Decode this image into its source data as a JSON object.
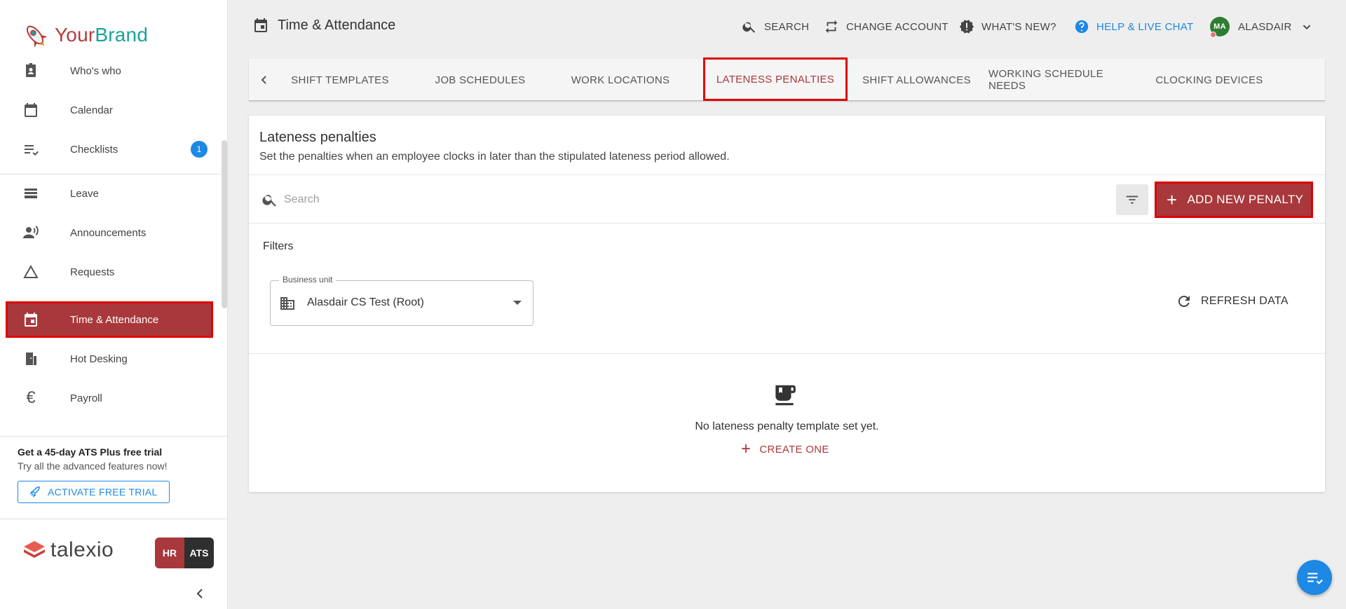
{
  "brand": {
    "your": "Your",
    "brand": "Brand"
  },
  "sidebar": {
    "items": [
      {
        "label": "Who's who",
        "icon": "badge-icon"
      },
      {
        "label": "Calendar",
        "icon": "calendar-icon"
      },
      {
        "label": "Checklists",
        "icon": "checklist-icon",
        "badge": "1"
      },
      {
        "label": "Leave",
        "icon": "leave-icon"
      },
      {
        "label": "Announcements",
        "icon": "announcements-icon"
      },
      {
        "label": "Requests",
        "icon": "triangle-icon"
      },
      {
        "label": "Time & Attendance",
        "icon": "calendar-event-icon",
        "active": true
      },
      {
        "label": "Hot Desking",
        "icon": "door-icon"
      },
      {
        "label": "Payroll",
        "icon": "euro-icon"
      }
    ],
    "promo": {
      "title": "Get a 45-day ATS Plus free trial",
      "subtitle": "Try all the advanced features now!",
      "button": "ACTIVATE FREE TRIAL"
    },
    "footer": {
      "logo_word": "talexio",
      "hr": "HR",
      "ats": "ATS"
    }
  },
  "header": {
    "title": "Time & Attendance",
    "search": "SEARCH",
    "change_account": "CHANGE ACCOUNT",
    "whats_new": "WHAT'S NEW?",
    "help": "HELP & LIVE CHAT",
    "avatar_initials": "MA",
    "user": "ALASDAIR"
  },
  "tabs": [
    "SHIFT TEMPLATES",
    "JOB SCHEDULES",
    "WORK LOCATIONS",
    "LATENESS PENALTIES",
    "SHIFT ALLOWANCES",
    "WORKING SCHEDULE NEEDS",
    "CLOCKING DEVICES"
  ],
  "main": {
    "title": "Lateness penalties",
    "subtitle": "Set the penalties when an employee clocks in later than the stipulated lateness period allowed.",
    "search_placeholder": "Search",
    "add_button": "ADD NEW PENALTY",
    "filters_label": "Filters",
    "business_unit_label": "Business unit",
    "business_unit_value": "Alasdair CS Test (Root)",
    "refresh": "REFRESH DATA",
    "empty_text": "No lateness penalty template set yet.",
    "create": "CREATE ONE"
  },
  "colors": {
    "accent": "#a8383b",
    "highlight": "#e00000",
    "link": "#1e88e5",
    "avatar": "#2e7d32"
  }
}
